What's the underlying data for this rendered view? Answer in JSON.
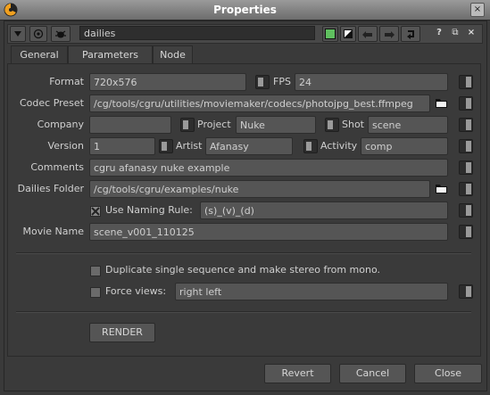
{
  "window": {
    "title": "Properties",
    "close_glyph": "×"
  },
  "toolbar": {
    "node_name": "dailies",
    "help_label": "?",
    "float_label": "⧉",
    "close_label": "×"
  },
  "tabs": [
    {
      "label": "General",
      "active": true
    },
    {
      "label": "Parameters",
      "active": false
    },
    {
      "label": "Node",
      "active": false
    }
  ],
  "form": {
    "format": {
      "label": "Format",
      "value": "720x576"
    },
    "fps": {
      "label": "FPS",
      "value": "24"
    },
    "codec_preset": {
      "label": "Codec Preset",
      "value": "/cg/tools/cgru/utilities/moviemaker/codecs/photojpg_best.ffmpeg"
    },
    "company": {
      "label": "Company",
      "value": ""
    },
    "project": {
      "label": "Project",
      "value": "Nuke"
    },
    "shot": {
      "label": "Shot",
      "value": "scene"
    },
    "version": {
      "label": "Version",
      "value": "1"
    },
    "artist": {
      "label": "Artist",
      "value": "Afanasy"
    },
    "activity": {
      "label": "Activity",
      "value": "comp"
    },
    "comments": {
      "label": "Comments",
      "value": "cgru afanasy nuke example"
    },
    "dailies_folder": {
      "label": "Dailies Folder",
      "value": "/cg/tools/cgru/examples/nuke"
    },
    "naming_rule": {
      "label": "Use Naming Rule:",
      "checked": true,
      "value": "(s)_(v)_(d)"
    },
    "movie_name": {
      "label": "Movie Name",
      "value": "scene_v001_110125"
    },
    "duplicate_stereo": {
      "label": "Duplicate single sequence and make stereo from mono.",
      "checked": false
    },
    "force_views": {
      "label": "Force views:",
      "checked": false,
      "value": "right left"
    },
    "render_label": "RENDER"
  },
  "footer": {
    "revert_label": "Revert",
    "cancel_label": "Cancel",
    "close_label": "Close"
  },
  "colors": {
    "titlebar": "#8a8a8a",
    "panel": "#3a3a3a",
    "field": "#555555",
    "accent_green": "#5fbf5f"
  }
}
